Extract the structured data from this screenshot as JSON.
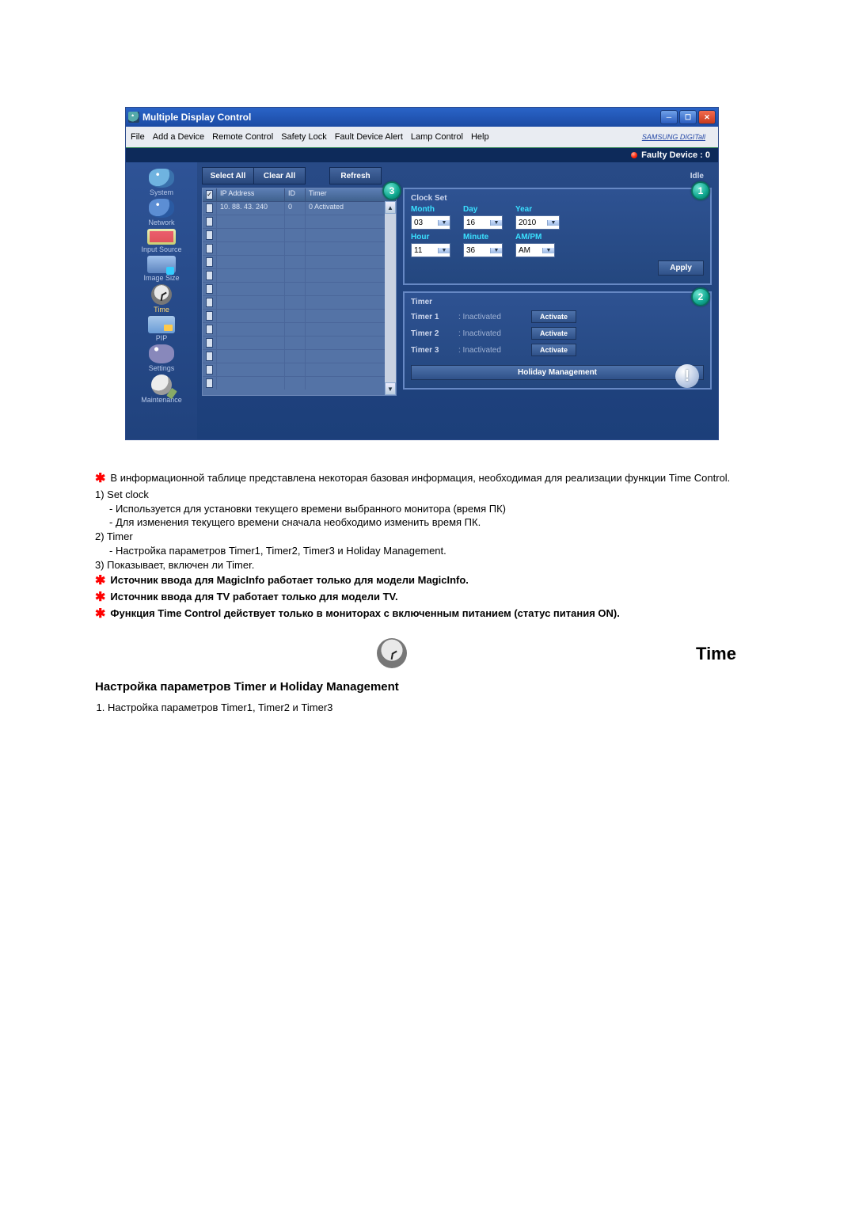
{
  "app": {
    "title": "Multiple Display Control",
    "menu": [
      "File",
      "Add a Device",
      "Remote Control",
      "Safety Lock",
      "Fault Device Alert",
      "Lamp Control",
      "Help"
    ],
    "brand": "SAMSUNG DIGITall",
    "faulty": "Faulty Device : 0",
    "toolbar": {
      "select_all": "Select All",
      "clear_all": "Clear All",
      "refresh": "Refresh"
    },
    "idle": "Idle",
    "sidebar": [
      {
        "label": "System"
      },
      {
        "label": "Network"
      },
      {
        "label": "Input Source"
      },
      {
        "label": "Image Size"
      },
      {
        "label": "Time"
      },
      {
        "label": "PIP"
      },
      {
        "label": "Settings"
      },
      {
        "label": "Maintenance"
      }
    ],
    "table": {
      "headers": {
        "ip": "IP Address",
        "id": "ID",
        "timer": "Timer"
      },
      "row": {
        "ip": "10. 88. 43. 240",
        "id": "0",
        "timer": "0 Activated"
      }
    },
    "clock": {
      "title": "Clock Set",
      "labels": {
        "month": "Month",
        "day": "Day",
        "year": "Year",
        "hour": "Hour",
        "minute": "Minute",
        "ampm": "AM/PM"
      },
      "values": {
        "month": "03",
        "day": "16",
        "year": "2010",
        "hour": "11",
        "minute": "36",
        "ampm": "AM"
      },
      "apply": "Apply"
    },
    "timer_panel": {
      "title": "Timer",
      "items": [
        {
          "name": "Timer 1",
          "status": ": Inactivated",
          "btn": "Activate"
        },
        {
          "name": "Timer 2",
          "status": ": Inactivated",
          "btn": "Activate"
        },
        {
          "name": "Timer 3",
          "status": ": Inactivated",
          "btn": "Activate"
        }
      ],
      "holiday": "Holiday Management"
    }
  },
  "doc": {
    "intro": "В информационной таблице представлена некоторая базовая информация, необходимая для реализации функции Time Control.",
    "n1": "1)  Set clock",
    "n1a": "- Используется для установки текущего времени выбранного монитора (время ПК)",
    "n1b": "- Для изменения текущего времени сначала необходимо изменить время ПК.",
    "n2": "2)  Timer",
    "n2a": "- Настройка параметров Timer1, Timer2, Timer3 и Holiday Management.",
    "n3": "3)  Показывает, включен ли Timer.",
    "s1": "Источник ввода для MagicInfo работает только для модели MagicInfo.",
    "s2": "Источник ввода для TV работает только для модели TV.",
    "s3": "Функция Time Control действует только в мониторах с включенным питанием (статус питания ON).",
    "sec_title": "Time",
    "subhead": "Настройка параметров Timer и Holiday Management",
    "ol1": "Настройка параметров Timer1, Timer2 и Timer3"
  }
}
